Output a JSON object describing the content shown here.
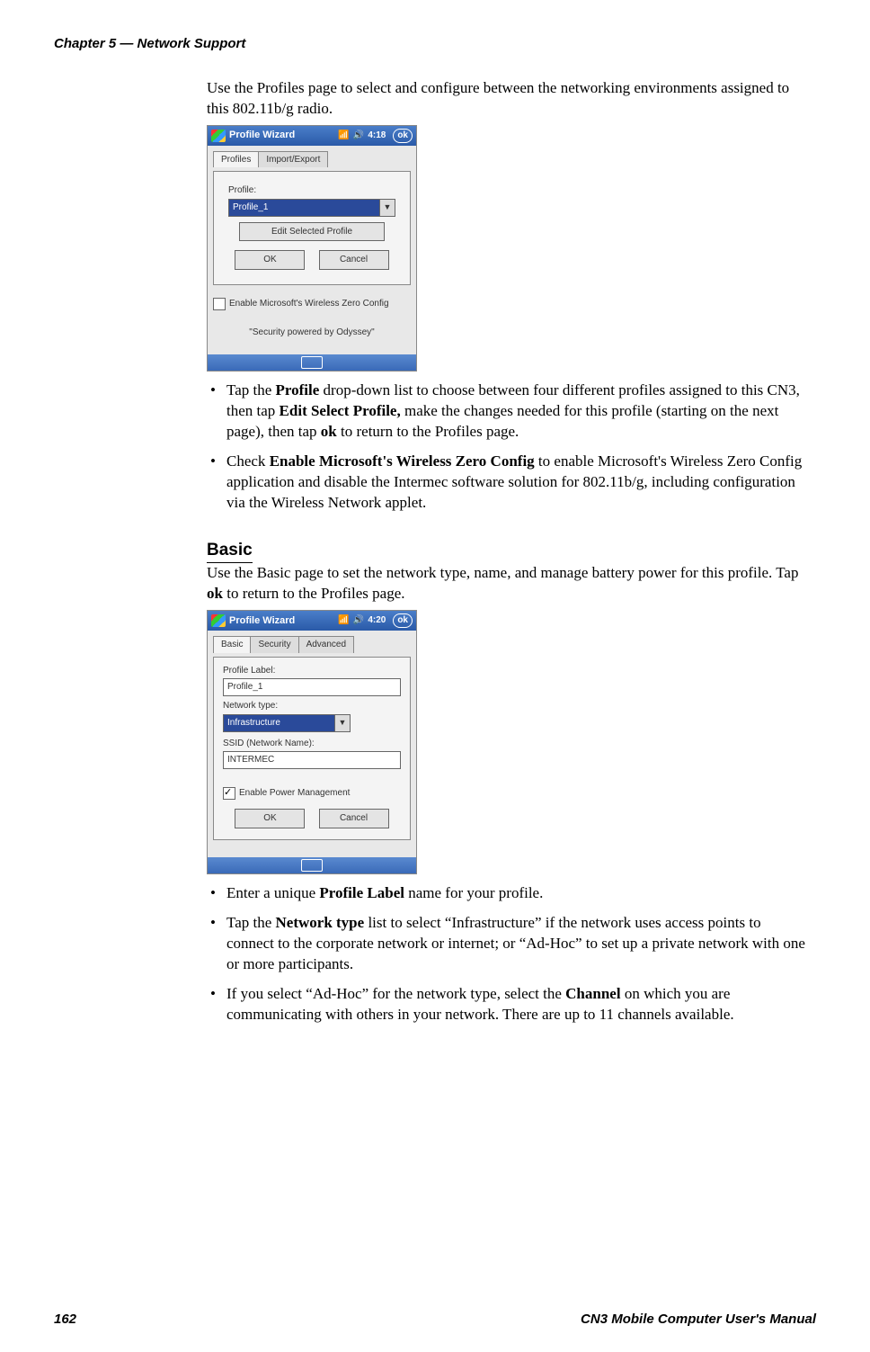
{
  "header": {
    "chapter": "Chapter 5 — Network Support"
  },
  "intro_para": "Use the Profiles page to select and configure between the networking environments assigned to this 802.11b/g radio.",
  "shot1": {
    "title": "Profile Wizard",
    "time": "4:18",
    "ok": "ok",
    "tab_profiles": "Profiles",
    "tab_importexport": "Import/Export",
    "profile_label": "Profile:",
    "profile_value": "Profile_1",
    "edit_btn": "Edit Selected Profile",
    "ok_btn": "OK",
    "cancel_btn": "Cancel",
    "enable_zero": "Enable Microsoft's Wireless Zero Config",
    "odyssey": "\"Security powered by Odyssey\""
  },
  "bullets1": {
    "b1_t1": "Tap the ",
    "b1_bold1": "Profile",
    "b1_t2": " drop-down list to choose between four different profiles assigned to this CN3, then tap ",
    "b1_bold2": "Edit Select Profile,",
    "b1_t3": " make the changes needed for this profile (starting on the next page), then tap ",
    "b1_bold3": "ok",
    "b1_t4": " to return to the Profiles page.",
    "b2_t1": "Check ",
    "b2_bold1": "Enable Microsoft's Wireless Zero Config",
    "b2_t2": " to enable Microsoft's Wireless Zero Config application and disable the Intermec software solution for 802.11b/g, including configuration via the Wireless Network applet."
  },
  "basic": {
    "heading": "Basic",
    "para_t1": "Use the Basic page to set the network type, name, and manage battery power for this profile. Tap ",
    "para_bold": "ok",
    "para_t2": " to return to the Profiles page."
  },
  "shot2": {
    "title": "Profile Wizard",
    "time": "4:20",
    "ok": "ok",
    "tab_basic": "Basic",
    "tab_security": "Security",
    "tab_advanced": "Advanced",
    "profile_label_lbl": "Profile Label:",
    "profile_label_val": "Profile_1",
    "network_type_lbl": "Network type:",
    "network_type_val": "Infrastructure",
    "ssid_lbl": "SSID (Network Name):",
    "ssid_val": "INTERMEC",
    "enable_power": "Enable Power Management",
    "ok_btn": "OK",
    "cancel_btn": "Cancel"
  },
  "bullets2": {
    "b1_t1": "Enter a unique ",
    "b1_bold1": "Profile Label",
    "b1_t2": " name for your profile.",
    "b2_t1": "Tap the ",
    "b2_bold1": "Network type",
    "b2_t2": " list to select “Infrastructure” if the network uses access points to connect to the corporate network or internet; or “Ad-Hoc” to set up a private network with one or more participants.",
    "b3_t1": "If you select “Ad-Hoc” for the network type, select the ",
    "b3_bold1": "Channel",
    "b3_t2": " on which you are communicating with others in your network. There are up to 11 channels available."
  },
  "footer": {
    "pagenum": "162",
    "title": "CN3 Mobile Computer User's Manual"
  }
}
